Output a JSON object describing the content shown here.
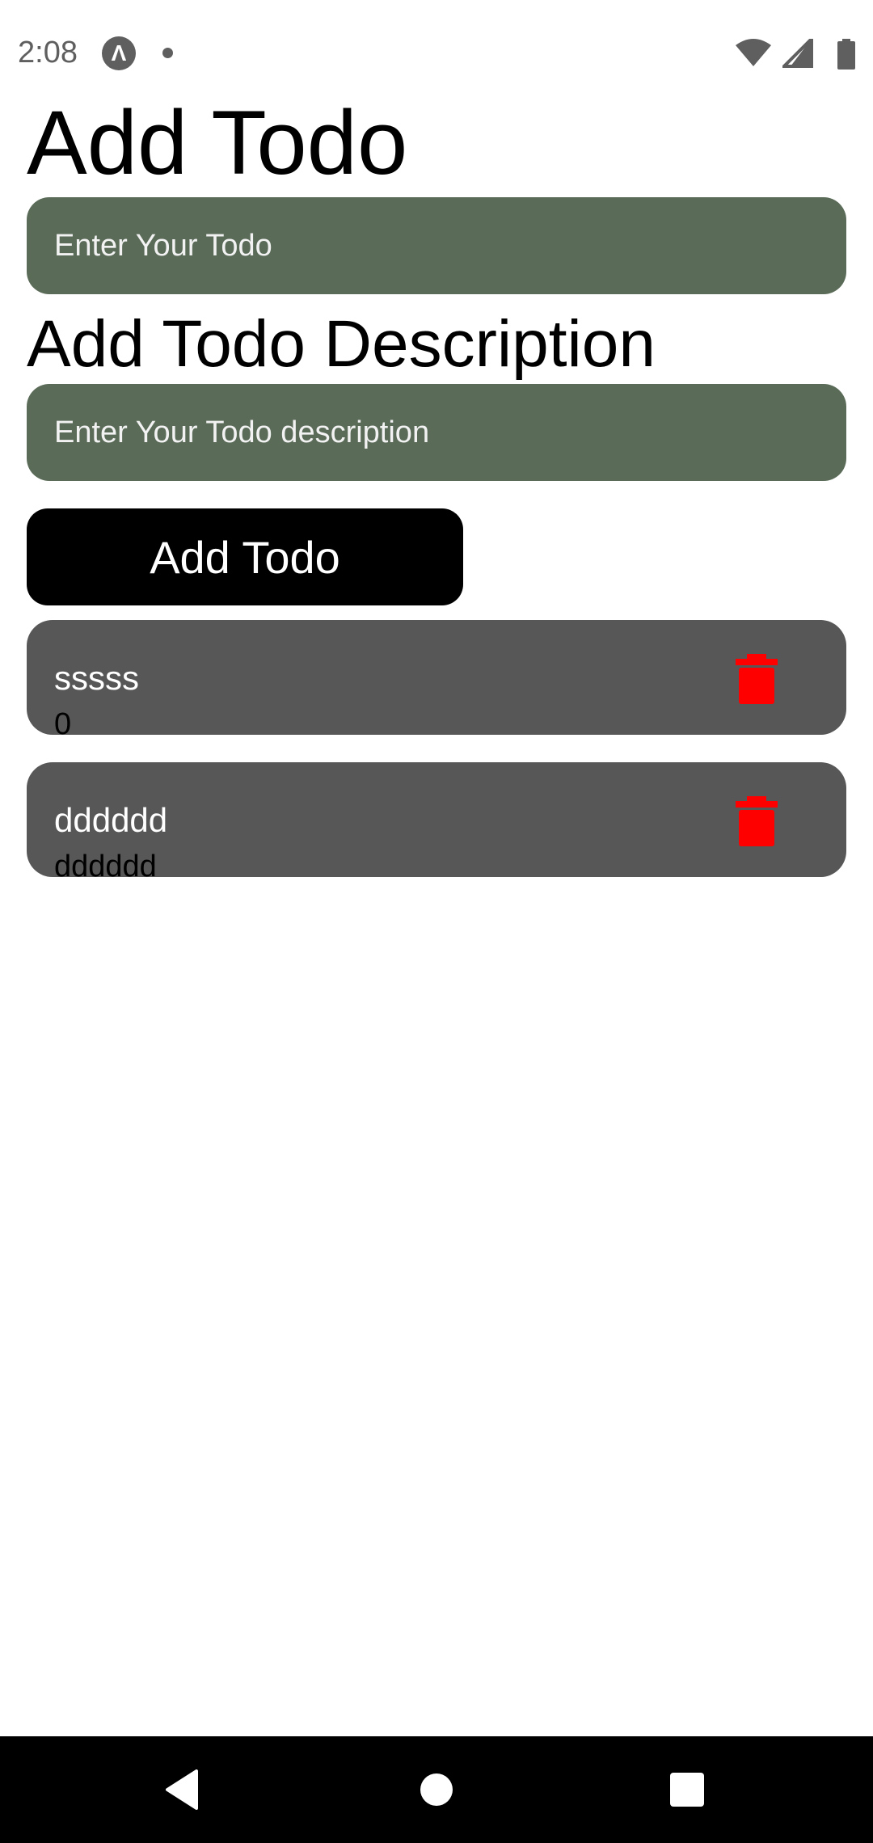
{
  "status": {
    "time": "2:08",
    "app_badge": "Λ",
    "icons": [
      "wifi-icon",
      "signal-icon",
      "battery-icon"
    ]
  },
  "title": "Add Todo",
  "description_heading": "Add Todo Description",
  "inputs": {
    "todo_placeholder": "Enter Your Todo",
    "description_placeholder": "Enter Your Todo description"
  },
  "add_button_label": "Add Todo",
  "todos": [
    {
      "title": "sssss",
      "description": "0"
    },
    {
      "title": "dddddd",
      "description": "dddddd"
    }
  ],
  "colors": {
    "input_bg": "#5a6b58",
    "card_bg": "#575757",
    "delete_icon": "#ff0000",
    "button_bg": "#000000"
  },
  "nav": [
    "back-icon",
    "home-icon",
    "recents-icon"
  ]
}
